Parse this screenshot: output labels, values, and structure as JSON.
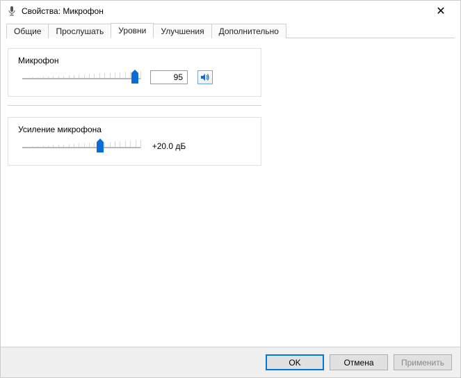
{
  "window": {
    "title": "Свойства: Микрофон"
  },
  "tabs": {
    "general": "Общие",
    "listen": "Прослушать",
    "levels": "Уровни",
    "enhancements": "Улучшения",
    "advanced": "Дополнительно",
    "active": "levels"
  },
  "levels": {
    "mic": {
      "label": "Микрофон",
      "value": "95",
      "percent": 95
    },
    "boost": {
      "label": "Усиление микрофона",
      "value": "+20.0 дБ",
      "percent": 66
    }
  },
  "footer": {
    "ok": "OK",
    "cancel": "Отмена",
    "apply": "Применить"
  }
}
